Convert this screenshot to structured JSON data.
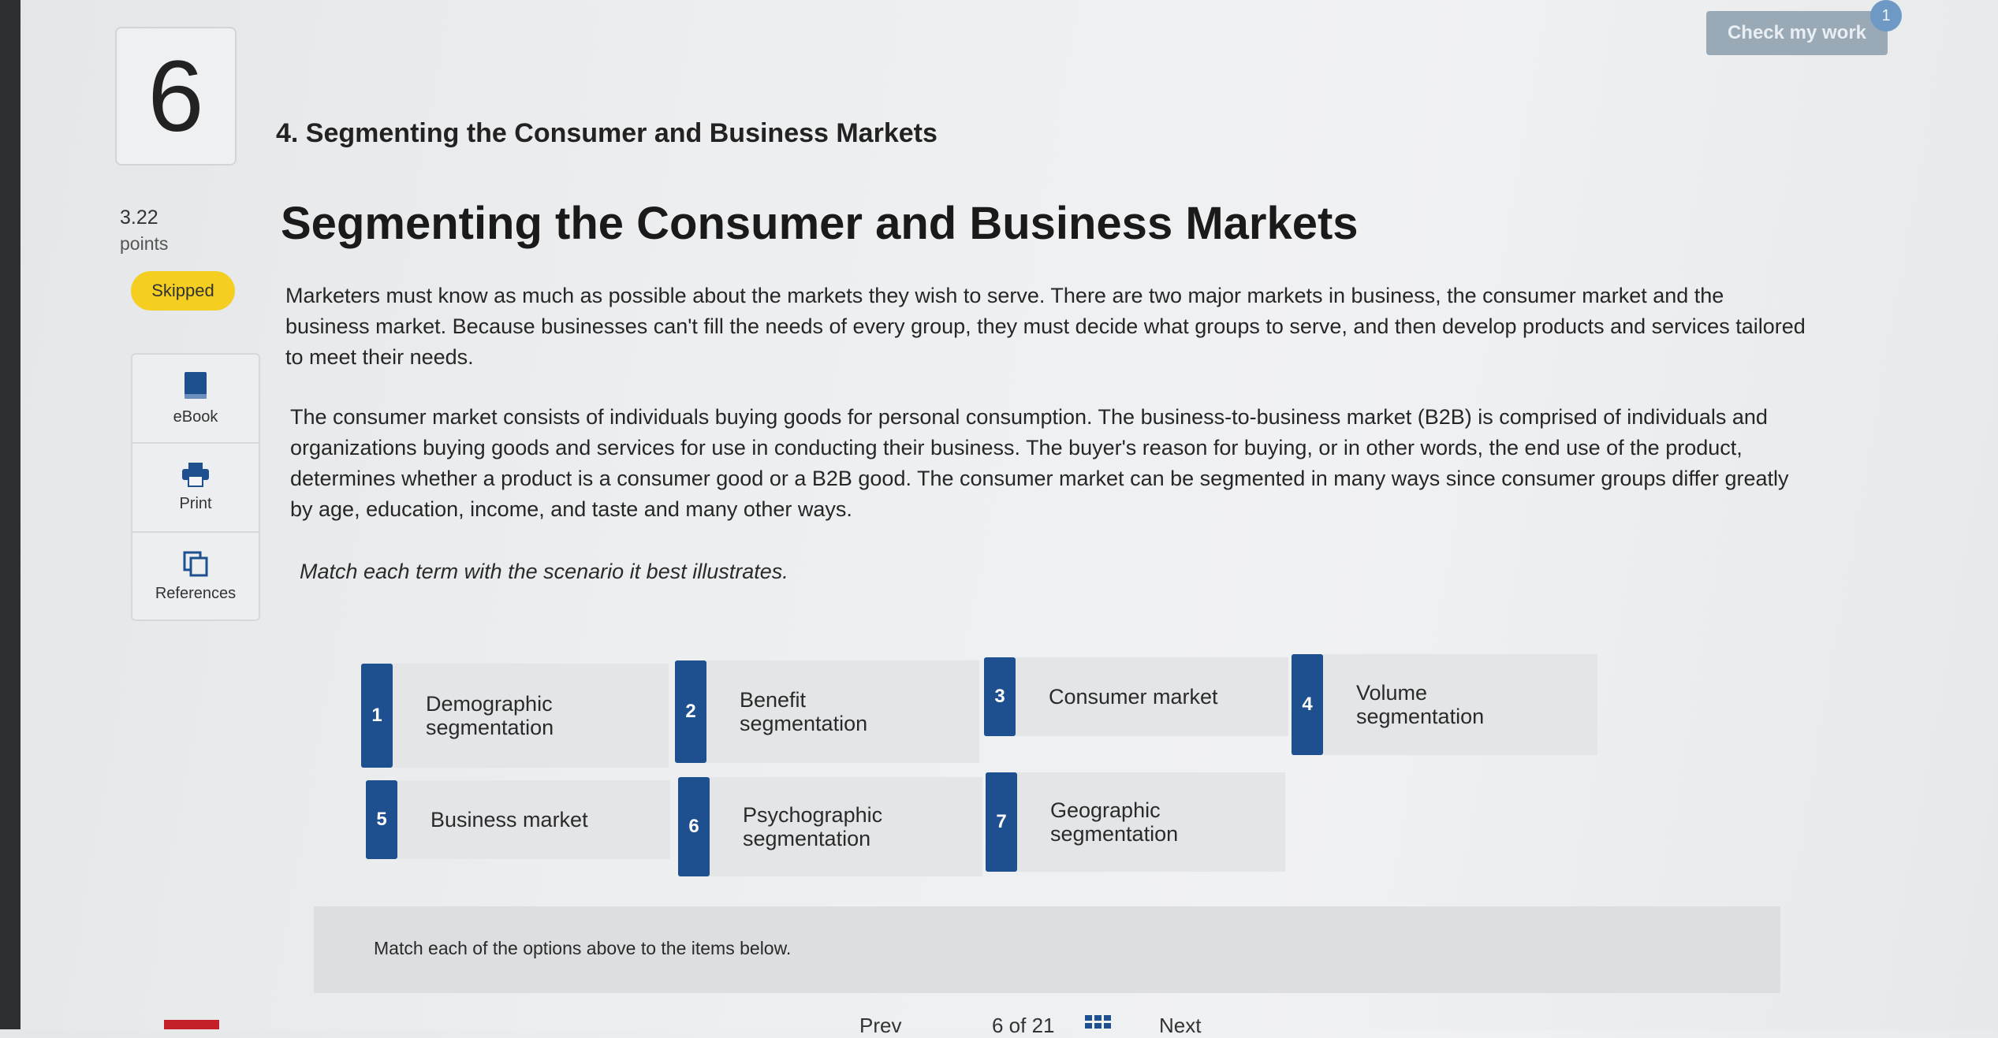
{
  "question": {
    "number": "6",
    "points_value": "3.22",
    "points_label": "points",
    "status": "Skipped"
  },
  "tools": [
    {
      "label": "eBook",
      "icon": "book-icon"
    },
    {
      "label": "Print",
      "icon": "printer-icon"
    },
    {
      "label": "References",
      "icon": "references-icon"
    }
  ],
  "header": {
    "check_button": "Check my work",
    "check_badge": "1"
  },
  "content": {
    "question_title": "4. Segmenting the Consumer and Business Markets",
    "main_title": "Segmenting the Consumer and Business Markets",
    "paragraph1": "Marketers must know as much as possible about the markets they wish to serve. There are two major markets in business, the consumer market and the business market. Because businesses can't fill the needs of every group, they must decide what groups to serve, and then develop products and services tailored to meet their needs.",
    "paragraph2": "The consumer market consists of individuals buying goods for personal consumption. The business-to-business market (B2B) is comprised of individuals and organizations buying goods and services for use in conducting their business. The buyer's reason for buying, or in other words, the end use of the product, determines whether a product is a consumer good or a B2B good. The consumer market can be segmented in many ways since consumer groups differ greatly by age, education, income, and taste and many other ways.",
    "instruction": "Match each term with the scenario it best illustrates."
  },
  "terms": [
    {
      "number": "1",
      "label": "Demographic segmentation"
    },
    {
      "number": "2",
      "label": "Benefit segmentation"
    },
    {
      "number": "3",
      "label": "Consumer market"
    },
    {
      "number": "4",
      "label": "Volume segmentation"
    },
    {
      "number": "5",
      "label": "Business market"
    },
    {
      "number": "6",
      "label": "Psychographic segmentation"
    },
    {
      "number": "7",
      "label": "Geographic segmentation"
    }
  ],
  "match_instruction": "Match each of the options above to the items below.",
  "footer": {
    "prev": "Prev",
    "page": "6 of 21",
    "next": "Next"
  },
  "colors": {
    "accent": "#1e4f8f",
    "skipped": "#f4cf22",
    "check_button": "#9aa9b6"
  }
}
